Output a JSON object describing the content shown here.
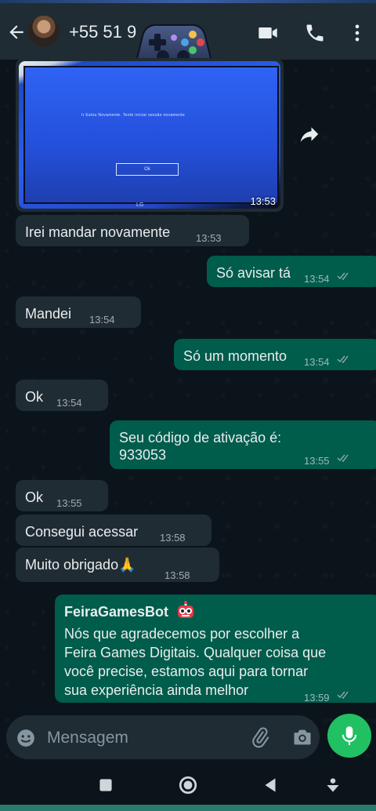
{
  "header": {
    "contact_name": "+55 51 9"
  },
  "messages": [
    {
      "id": "m0",
      "type": "image",
      "direction": "in",
      "time": "13:53",
      "photo_text": "Ir Estou Novamente. Tente iniciar sessão novamente",
      "photo_button": "Ok",
      "photo_brand": "LG"
    },
    {
      "id": "m1",
      "direction": "in",
      "text": "Irei mandar novamente",
      "time": "13:53"
    },
    {
      "id": "m2",
      "direction": "out",
      "text": "Só avisar tá",
      "time": "13:54"
    },
    {
      "id": "m3",
      "direction": "in",
      "text": "Mandei",
      "time": "13:54"
    },
    {
      "id": "m4",
      "direction": "out",
      "text": "Só um momento",
      "time": "13:54"
    },
    {
      "id": "m5",
      "direction": "in",
      "text": "Ok",
      "time": "13:54"
    },
    {
      "id": "m6",
      "direction": "out",
      "text_line1": "Seu código de ativação é:",
      "text_line2": "933053",
      "time": "13:55"
    },
    {
      "id": "m7",
      "direction": "in",
      "text": "Ok",
      "time": "13:55"
    },
    {
      "id": "m8",
      "direction": "in",
      "text": "Consegui acessar",
      "time": "13:58"
    },
    {
      "id": "m9",
      "direction": "in",
      "text": "Muito obrigado🙏",
      "time": "13:58"
    },
    {
      "id": "m10",
      "direction": "out",
      "sender": "FeiraGamesBot",
      "text": "Nós que agradecemos por escolher a\nFeira Games Digitais. Qualquer coisa que\nvocê precise, estamos aqui para tornar\nsua experiência ainda melhor",
      "time": "13:59"
    }
  ],
  "composer": {
    "placeholder": "Mensagem"
  },
  "colors": {
    "header_bg": "#1f2c33",
    "incoming_bubble": "#202c33",
    "outgoing_bubble": "#005c4b",
    "accent_green": "#21c063",
    "chat_bg": "#0b141a",
    "read_ticks": "#53bdeb"
  },
  "icons": [
    "back-arrow-icon",
    "gamepad-icon",
    "video-call-icon",
    "phone-icon",
    "more-options-icon",
    "forward-icon",
    "double-check-icon",
    "robot-icon",
    "emoji-icon",
    "attach-icon",
    "camera-icon",
    "mic-icon",
    "nav-recents-icon",
    "nav-home-icon",
    "nav-back-icon",
    "nav-menu-icon"
  ]
}
